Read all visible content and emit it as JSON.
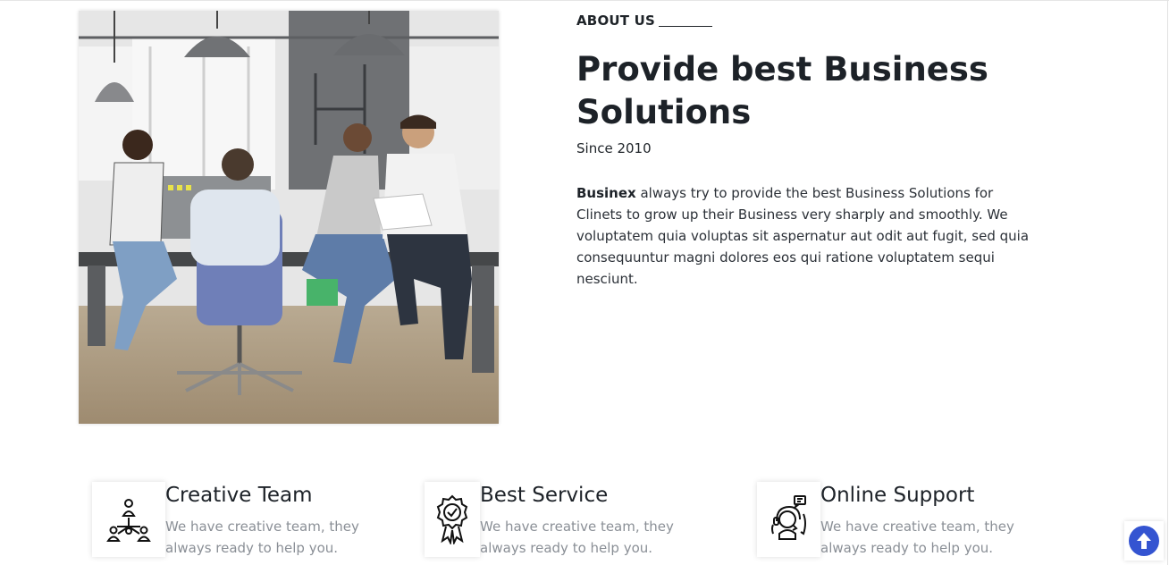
{
  "about": {
    "eyebrow": "ABOUT US",
    "headline": "Provide best Business Solutions",
    "since": "Since 2010",
    "brand": "Businex",
    "description": " always try to provide the best Business Solutions for Clinets to grow up their Business very sharply and smoothly. We voluptatem quia voluptas sit aspernatur aut odit aut fugit, sed quia consequuntur magni dolores eos qui ratione voluptatem sequi nesciunt."
  },
  "features": [
    {
      "icon": "team-hierarchy-icon",
      "title": "Creative Team",
      "text": "We have creative team, they always ready to help you."
    },
    {
      "icon": "award-badge-icon",
      "title": "Best Service",
      "text": "We have creative team, they always ready to help you."
    },
    {
      "icon": "support-agent-icon",
      "title": "Online Support",
      "text": "We have creative team, they always ready to help you."
    }
  ],
  "colors": {
    "accent": "#3454d1",
    "heading": "#1d2228",
    "muted": "#8a8f96"
  }
}
